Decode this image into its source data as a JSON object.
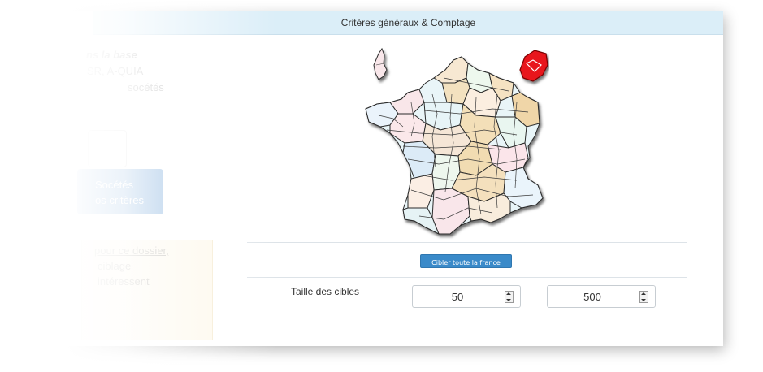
{
  "header": {
    "title": "Critères généraux & Comptage"
  },
  "sidebar_ghost": {
    "line1": "ns la base",
    "line2": "SR, A-QUIA",
    "line3": "socétés",
    "button_line1": "Socétés",
    "button_line2": "os critères",
    "note_line1": "pour ce dossier,",
    "note_line2": "ciblage",
    "note_line3": "intéressent"
  },
  "map": {
    "highlighted_region": "Alsace",
    "highlight_color": "#e8141c"
  },
  "actions": {
    "target_all_label": "Cibler toute la france"
  },
  "target_size": {
    "label": "Taille des cibles",
    "min_value": "50",
    "max_value": "500"
  },
  "colors": {
    "header_bg": "#dbeef8",
    "button_bg": "#3a8ac9"
  }
}
